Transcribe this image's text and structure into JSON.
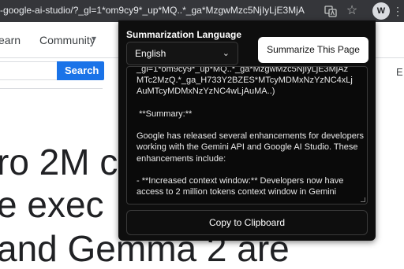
{
  "browser": {
    "url": "-google-ai-studio/?_gl=1*om9cy9*_up*MQ..*_ga*MzgwMzc5NjIyLjE3MjA",
    "extension_letter": "W",
    "icons": {
      "translate": "translate-icon",
      "star": "star-icon",
      "menu": "more-vert-icon"
    }
  },
  "site": {
    "nav": {
      "learn": "earn",
      "community": "Community"
    },
    "search_button": "Search",
    "right_edge_letter": "E",
    "headline": [
      "ro 2M c",
      "e exec",
      "and Gemma 2 are"
    ]
  },
  "popup": {
    "label": "Summarization Language",
    "language_value": "English",
    "summarize_button": "Summarize This Page",
    "summary": "_gl=1*om9cy9*_up*MQ..*_ga*MzgwMzc5NjIyLjE3MjAz\nMTc2MzQ.*_ga_H733Y2BZES*MTcyMDMxNzYzNC4xLj\nAuMTcyMDMxNzYzNC4wLjAuMA..)\n\n **Summary:**\n\nGoogle has released several enhancements for developers working with the Gemini API and Google AI Studio. These enhancements include:\n\n- **Increased context window:** Developers now have\naccess to 2 million tokens context window in Gemini",
    "copy_button": "Copy to Clipboard"
  },
  "colors": {
    "browser_toolbar": "#35363a",
    "popup_bg": "#0e0e0e",
    "search_button": "#1a73e8"
  }
}
